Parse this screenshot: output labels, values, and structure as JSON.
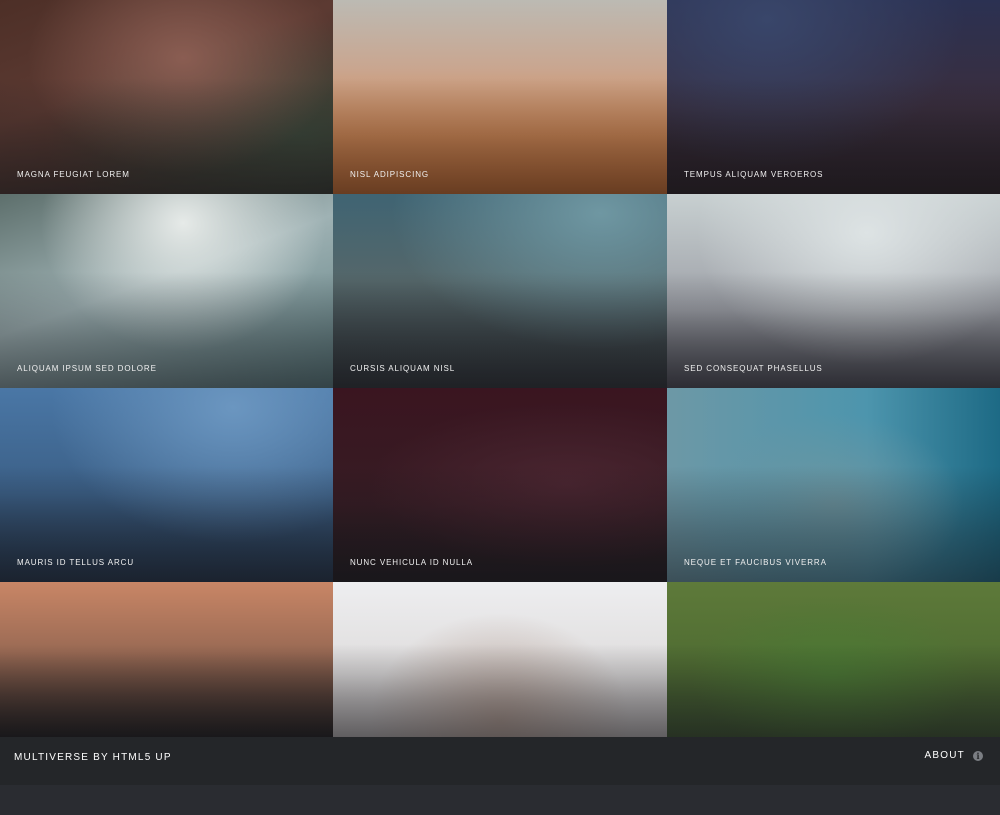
{
  "gallery": {
    "items": [
      {
        "title": "MAGNA FEUGIAT LOREM"
      },
      {
        "title": "NISL ADIPISCING"
      },
      {
        "title": "TEMPUS ALIQUAM VEROEROS"
      },
      {
        "title": "ALIQUAM IPSUM SED DOLORE"
      },
      {
        "title": "CURSIS ALIQUAM NISL"
      },
      {
        "title": "SED CONSEQUAT PHASELLUS"
      },
      {
        "title": "MAURIS ID TELLUS ARCU"
      },
      {
        "title": "NUNC VEHICULA ID NULLA"
      },
      {
        "title": "NEQUE ET FAUCIBUS VIVERRA"
      },
      {
        "title": ""
      },
      {
        "title": ""
      },
      {
        "title": ""
      }
    ]
  },
  "footer": {
    "site_title": "MULTIVERSE BY HTML5 UP",
    "about_label": "ABOUT",
    "about_icon": "info-icon"
  },
  "colors": {
    "footer_bg": "#242629",
    "bottom_strip_bg": "#2a2c31",
    "text": "#ffffff",
    "icon_bg": "#7b7e83"
  }
}
